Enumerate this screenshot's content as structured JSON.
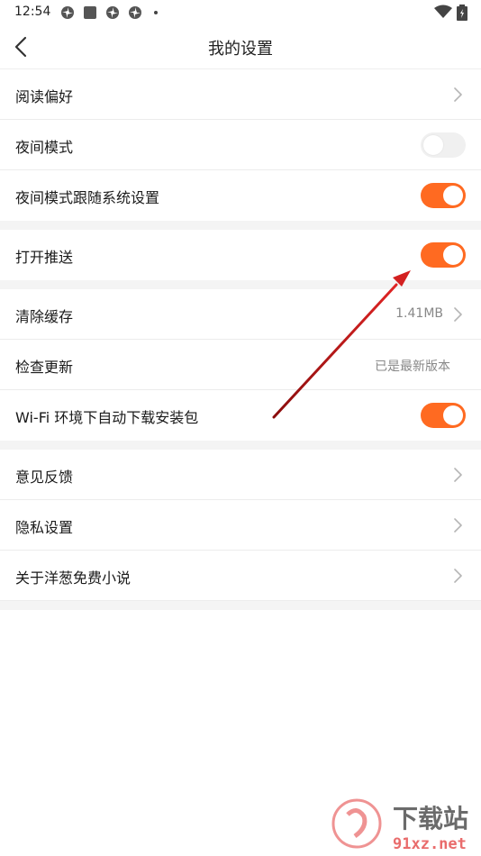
{
  "status_bar": {
    "time": "12:54",
    "icons": [
      "pinwheel-icon",
      "square-app-icon",
      "pinwheel-icon",
      "pinwheel-icon"
    ],
    "right_icons": [
      "wifi-icon",
      "battery-icon"
    ]
  },
  "header": {
    "title": "我的设置",
    "back_icon": "chevron-left-icon"
  },
  "sections": {
    "s1": {
      "reading": {
        "label": "阅读偏好"
      },
      "night": {
        "label": "夜间模式",
        "on": false
      },
      "night_follow": {
        "label": "夜间模式跟随系统设置",
        "on": true
      }
    },
    "s2": {
      "push": {
        "label": "打开推送",
        "on": true
      }
    },
    "s3": {
      "cache": {
        "label": "清除缓存",
        "value": "1.41MB"
      },
      "update": {
        "label": "检查更新",
        "value": "已是最新版本"
      },
      "wifi_dl": {
        "label": "Wi-Fi 环境下自动下载安装包",
        "on": true
      }
    },
    "s4": {
      "feedback": {
        "label": "意见反馈"
      },
      "privacy": {
        "label": "隐私设置"
      },
      "about": {
        "label": "关于洋葱免费小说"
      }
    }
  },
  "colors": {
    "accent": "#ff6a21",
    "toggle_off": "#f0f0f0",
    "section_gap": "#f4f4f4",
    "annotation_arrow": "#d32020"
  },
  "watermark": {
    "brand": "下载站",
    "domain": "91xz.net"
  }
}
